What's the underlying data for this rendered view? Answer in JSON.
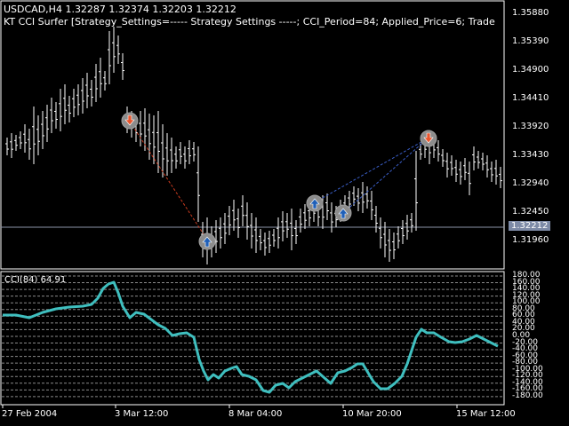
{
  "header": {
    "symbol_line": "USDCAD,H4  1.32287 1.32374 1.32203 1.32212",
    "indicator_line": "KT CCI Surfer [Strategy_Settings=----- Strategy Settings -----; CCI_Period=84; Applied_Price=6; Trade"
  },
  "price_axis": {
    "labels": [
      "1.35880",
      "1.35390",
      "1.34900",
      "1.34410",
      "1.33920",
      "1.33430",
      "1.32940",
      "1.32450",
      "1.31960"
    ],
    "current": "1.32212"
  },
  "cci_panel": {
    "label": "CCI(84) 64.91",
    "axis_labels": [
      "180.00",
      "160.00",
      "140.00",
      "120.00",
      "100.00",
      "80.00",
      "60.00",
      "40.00",
      "20.00",
      "0.00",
      "-20.00",
      "-40.00",
      "-60.00",
      "-80.00",
      "-100.00",
      "-120.00",
      "-140.00",
      "-160.00",
      "-180.00"
    ],
    "line_color": "#3fbfbf"
  },
  "time_axis": {
    "labels": [
      "27 Feb 2004",
      "3 Mar 12:00",
      "8 Mar 04:00",
      "10 Mar 20:00",
      "15 Mar 12:00"
    ]
  },
  "signals": [
    {
      "type": "sell",
      "icon": "arrow-down-icon"
    },
    {
      "type": "buy",
      "icon": "arrow-up-icon"
    },
    {
      "type": "buy",
      "icon": "arrow-up-icon"
    },
    {
      "type": "buy",
      "icon": "arrow-up-icon"
    },
    {
      "type": "sell",
      "icon": "arrow-down-icon"
    }
  ],
  "colors": {
    "background": "#000000",
    "candles": "#ffffff",
    "sell_arrow": "#e8542c",
    "buy_arrow": "#1f5fb8",
    "signal_circle": "#8c8c8c",
    "current_price_bg": "#7d8aa6",
    "sell_line": "#c83a1e",
    "buy_line": "#3a5ec8"
  }
}
